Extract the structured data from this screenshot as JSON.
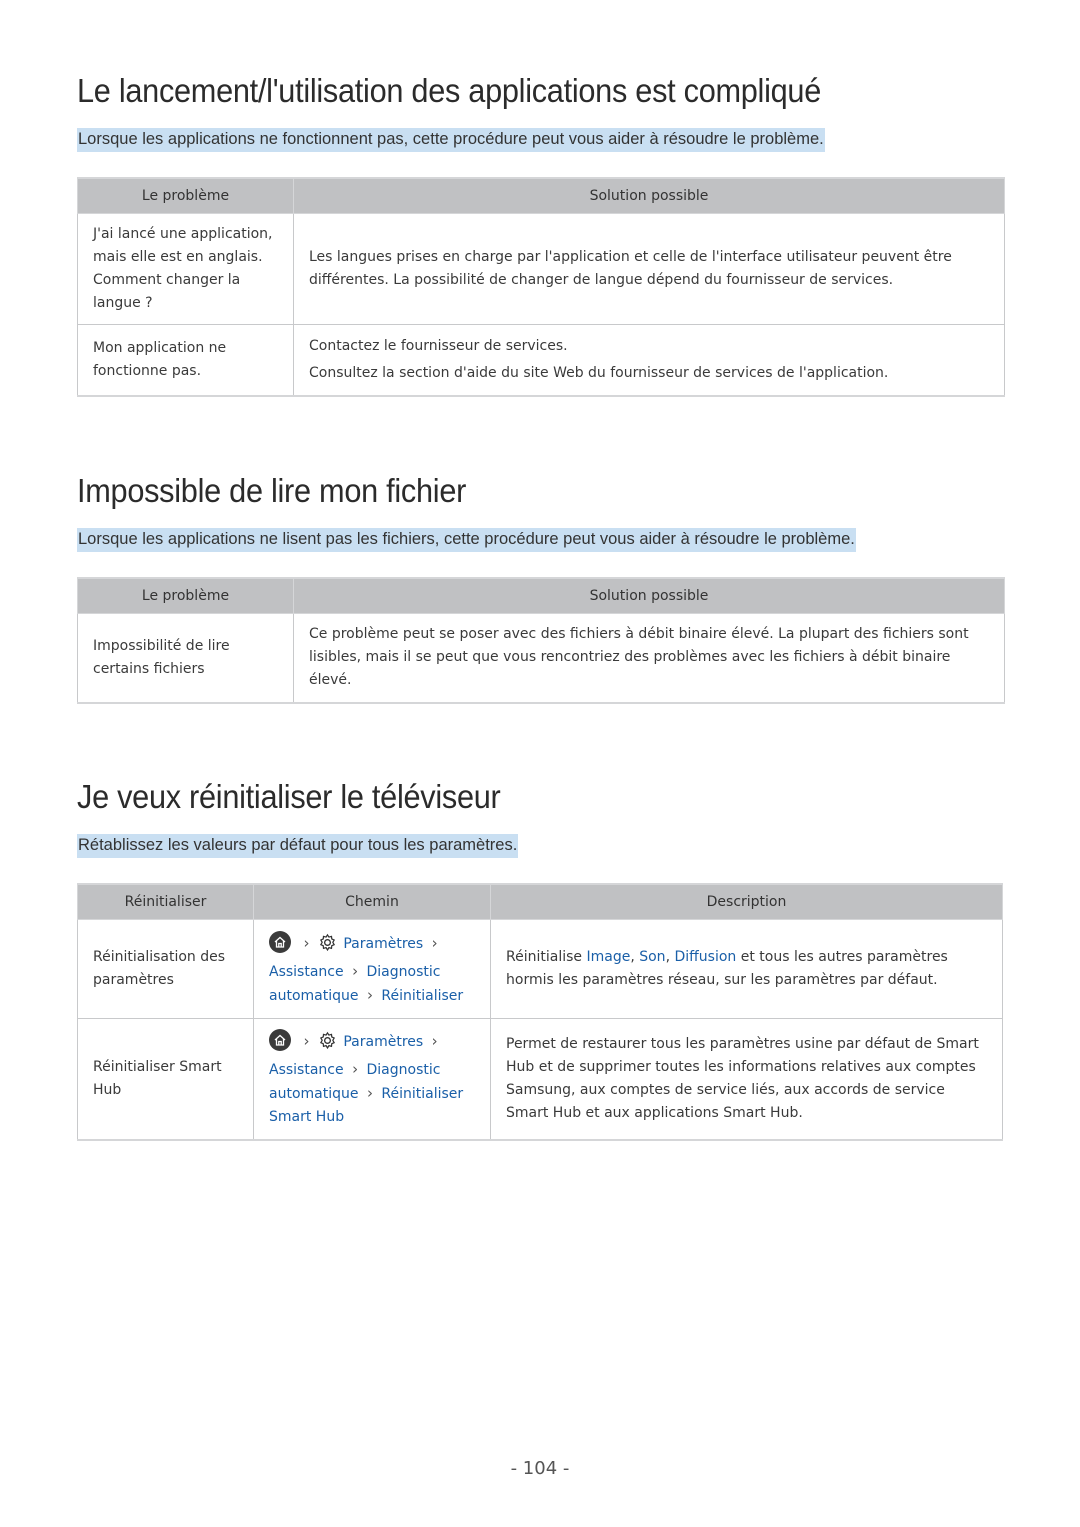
{
  "sections": [
    {
      "title": "Le lancement/l'utilisation des applications est compliqué",
      "intro": "Lorsque les applications ne fonctionnent pas, cette procédure peut vous aider à résoudre le problème.",
      "headers": [
        "Le problème",
        "Solution possible"
      ],
      "rows": [
        {
          "problem": "J'ai lancé une application, mais elle est en anglais. Comment changer la langue ?",
          "solution": [
            "Les langues prises en charge par l'application et celle de l'interface utilisateur peuvent être différentes. La possibilité de changer de langue dépend du fournisseur de services."
          ]
        },
        {
          "problem": "Mon application ne fonctionne pas.",
          "solution": [
            "Contactez le fournisseur de services.",
            "Consultez la section d'aide du site Web du fournisseur de services de l'application."
          ]
        }
      ]
    },
    {
      "title": "Impossible de lire mon fichier",
      "intro": "Lorsque les applications ne lisent pas les fichiers, cette procédure peut vous aider à résoudre le problème.",
      "headers": [
        "Le problème",
        "Solution possible"
      ],
      "rows": [
        {
          "problem": "Impossibilité de lire certains fichiers",
          "solution": [
            "Ce problème peut se poser avec des fichiers à débit binaire élevé. La plupart des fichiers sont lisibles, mais il se peut que vous rencontriez des problèmes avec les fichiers à débit binaire élevé."
          ]
        }
      ]
    },
    {
      "title": "Je veux réinitialiser le téléviseur",
      "intro": "Rétablissez les valeurs par défaut pour tous les paramètres.",
      "headers": [
        "Réinitialiser",
        "Chemin",
        "Description"
      ],
      "rows": [
        {
          "reset": "Réinitialisation des paramètres",
          "path": [
            "Paramètres",
            "Assistance",
            "Diagnostic automatique",
            "Réinitialiser"
          ],
          "description": {
            "prefix": "Réinitialise ",
            "link1": "Image",
            "sep1": ", ",
            "link2": "Son",
            "sep2": ", ",
            "link3": "Diffusion",
            "suffix": " et tous les autres paramètres hormis les paramètres réseau, sur les paramètres par défaut."
          }
        },
        {
          "reset": "Réinitialiser Smart Hub",
          "path": [
            "Paramètres",
            "Assistance",
            "Diagnostic automatique",
            "Réinitialiser Smart Hub"
          ],
          "description_text": "Permet de restaurer tous les paramètres usine par défaut de Smart Hub et de supprimer toutes les informations relatives aux comptes Samsung, aux comptes de service liés, aux accords de service Smart Hub et aux applications Smart Hub."
        }
      ]
    }
  ],
  "path_parts": {
    "assistance": "Assistance",
    "diagnostic": "Diagnostic",
    "automatique": "automatique"
  },
  "icons": {
    "home": "home-icon",
    "settings": "gear-icon",
    "chevron": "chevron-right-icon"
  },
  "colors": {
    "link_blue": "#1a5fa8",
    "highlight": "#c9dff2",
    "header_gray": "#c0c1c3"
  },
  "page_number": "- 104 -"
}
